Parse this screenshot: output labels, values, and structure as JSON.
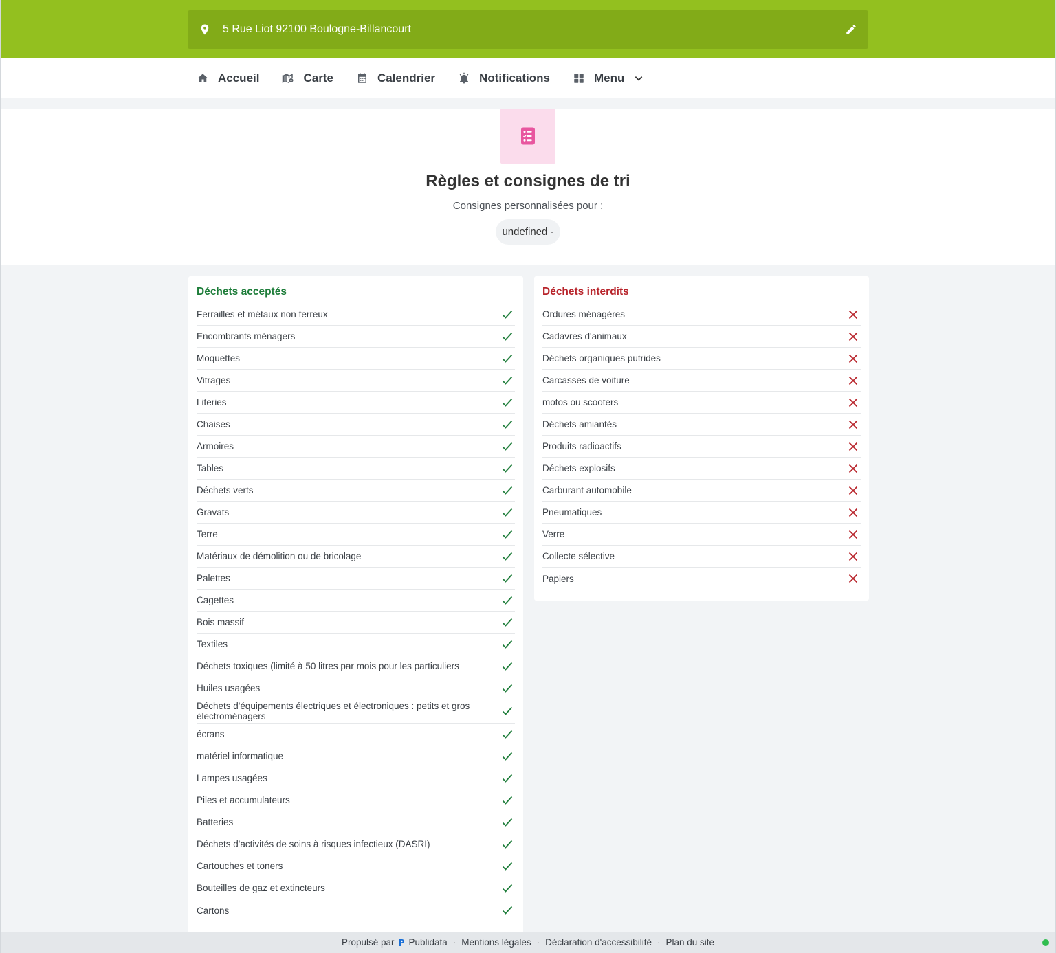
{
  "address": {
    "text": "5 Rue Liot 92100 Boulogne-Billancourt"
  },
  "nav": {
    "items": [
      {
        "label": "Accueil",
        "icon": "home-icon"
      },
      {
        "label": "Carte",
        "icon": "map-icon"
      },
      {
        "label": "Calendrier",
        "icon": "calendar-icon"
      },
      {
        "label": "Notifications",
        "icon": "bell-icon"
      },
      {
        "label": "Menu",
        "icon": "grid-icon"
      }
    ]
  },
  "hero": {
    "icon": "checklist-icon",
    "title": "Règles et consignes de tri",
    "subtitle": "Consignes personnalisées pour :",
    "pill": "undefined -"
  },
  "accepted": {
    "title": "Déchets acceptés",
    "items": [
      "Ferrailles et métaux non ferreux",
      "Encombrants ménagers",
      "Moquettes",
      "Vitrages",
      "Literies",
      "Chaises",
      "Armoires",
      "Tables",
      "Déchets verts",
      "Gravats",
      "Terre",
      "Matériaux de démolition ou de bricolage",
      "Palettes",
      "Cagettes",
      "Bois massif",
      "Textiles",
      "Déchets toxiques (limité à 50 litres par mois pour les particuliers",
      "Huiles usagées",
      "Déchets d'équipements électriques et électroniques : petits et gros électroménagers",
      "écrans",
      "matériel informatique",
      "Lampes usagées",
      "Piles et accumulateurs",
      "Batteries",
      "Déchets d'activités de soins à risques infectieux (DASRI)",
      "Cartouches et toners",
      "Bouteilles de gaz et extincteurs",
      "Cartons"
    ]
  },
  "forbidden": {
    "title": "Déchets interdits",
    "items": [
      "Ordures ménagères",
      "Cadavres d'animaux",
      "Déchets organiques putrides",
      "Carcasses de voiture",
      "motos ou scooters",
      "Déchets amiantés",
      "Produits radioactifs",
      "Déchets explosifs",
      "Carburant automobile",
      "Pneumatiques",
      "Verre",
      "Collecte sélective",
      "Papiers"
    ]
  },
  "footer": {
    "powered": "Propulsé par",
    "brand": "Publidata",
    "links": [
      "Mentions légales",
      "Déclaration d'accessibilité",
      "Plan du site"
    ]
  },
  "colors": {
    "topbar": "#93c01f",
    "accepted": "#1e7d3a",
    "forbidden": "#b8242b",
    "hero_icon_bg": "#fbdcec",
    "hero_icon": "#e8569f"
  }
}
